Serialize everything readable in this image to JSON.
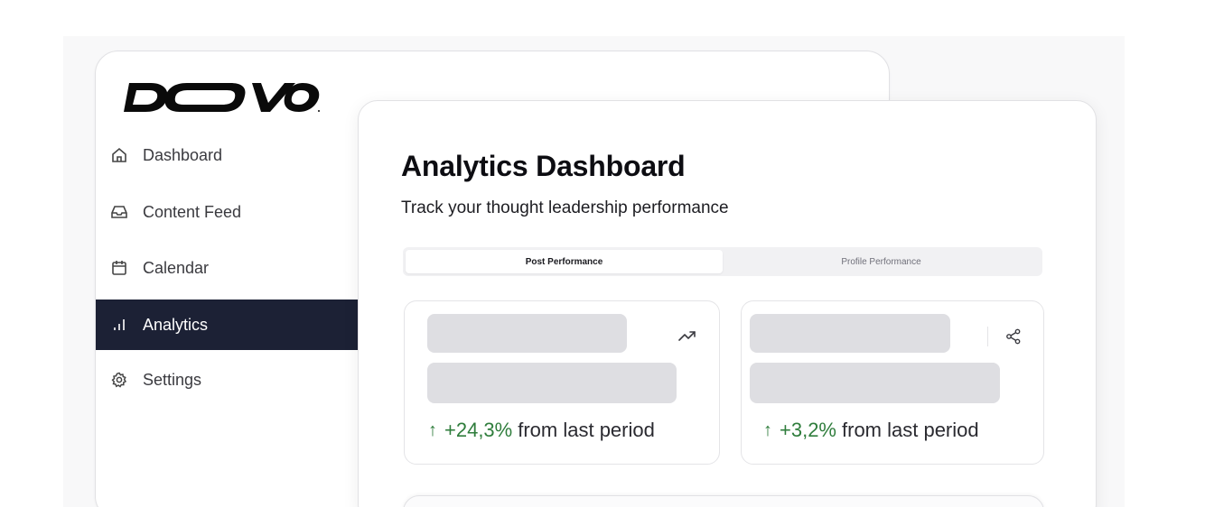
{
  "brand": {
    "logo_text": "DOVO"
  },
  "sidebar": {
    "items": [
      {
        "label": "Dashboard",
        "icon": "home-icon",
        "active": false
      },
      {
        "label": "Content Feed",
        "icon": "inbox-icon",
        "active": false
      },
      {
        "label": "Calendar",
        "icon": "calendar-icon",
        "active": false
      },
      {
        "label": "Analytics",
        "icon": "bar-chart-icon",
        "active": true
      },
      {
        "label": "Settings",
        "icon": "gear-icon",
        "active": false
      }
    ]
  },
  "main": {
    "title": "Analytics Dashboard",
    "subtitle": "Track your thought leadership performance",
    "tabs": [
      {
        "label": "Post Performance",
        "active": true
      },
      {
        "label": "Profile Performance",
        "active": false
      }
    ],
    "metrics": [
      {
        "icon": "trending-up-icon",
        "change": "+24,3%",
        "arrow": "↑",
        "suffix": "from last period"
      },
      {
        "icon": "share-icon",
        "change": "+3,2%",
        "arrow": "↑",
        "suffix": "from last period"
      }
    ]
  },
  "colors": {
    "accent_dark": "#1c2135",
    "positive": "#2f7d3c",
    "skeleton": "#dedee2"
  }
}
